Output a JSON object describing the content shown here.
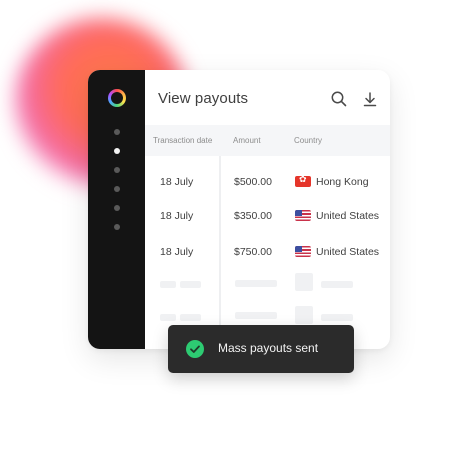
{
  "panel": {
    "title": "View payouts",
    "icons": {
      "search": "search-icon",
      "download": "download-icon",
      "logo": "ring-logo"
    }
  },
  "table": {
    "headers": [
      "Transaction date",
      "Amount",
      "Country"
    ],
    "rows": [
      {
        "date": "18 July",
        "amount": "$500.00",
        "country": "Hong Kong",
        "flag": "hk-flag-icon"
      },
      {
        "date": "18 July",
        "amount": "$350.00",
        "country": "United States",
        "flag": "us-flag-icon"
      },
      {
        "date": "18 July",
        "amount": "$750.00",
        "country": "United States",
        "flag": "us-flag-icon"
      }
    ]
  },
  "toast": {
    "message": "Mass payouts sent",
    "icon": "check-circle-icon"
  },
  "colors": {
    "accent": "#2dcb72",
    "sidebar": "#141414",
    "blob": "#ff7a4a"
  }
}
